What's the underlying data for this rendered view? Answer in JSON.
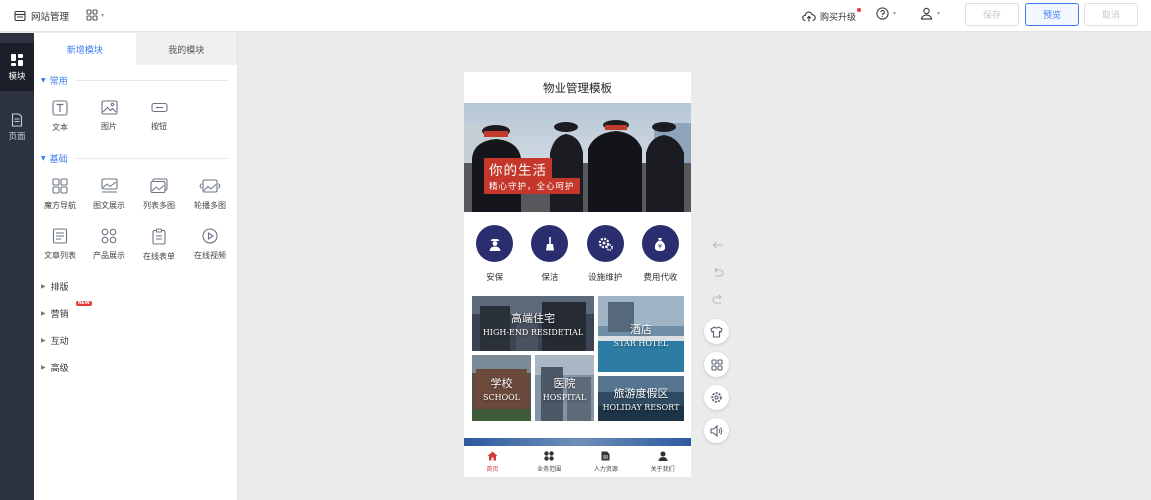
{
  "header": {
    "site_title": "网站管理",
    "upgrade_label": "购买升级",
    "save_label": "保存",
    "preview_label": "预览",
    "cancel_label": "取消"
  },
  "rail": {
    "items": [
      {
        "label": "模块",
        "icon": "modules-icon"
      },
      {
        "label": "页面",
        "icon": "page-icon"
      }
    ]
  },
  "panel": {
    "tabs": [
      "新增模块",
      "我的模块"
    ],
    "sections": {
      "common": {
        "title": "常用",
        "items": [
          "文本",
          "图片",
          "按钮"
        ]
      },
      "basic": {
        "title": "基础",
        "items": [
          "魔方导航",
          "图文展示",
          "列表多图",
          "轮播多图",
          "文章列表",
          "产品展示",
          "在线表单",
          "在线视频"
        ]
      },
      "collapsed": [
        "排版",
        "营销",
        "互动",
        "高级"
      ],
      "new_badge": "NEW"
    }
  },
  "phone": {
    "title": "物业管理模板",
    "banner": {
      "caption_main": "你的生活",
      "caption_sub": "精心守护，全心呵护"
    },
    "services": [
      "安保",
      "保洁",
      "设施维护",
      "费用代收"
    ],
    "tiles": [
      {
        "zh": "高端住宅",
        "en": "HIGH-END RESIDETIAL"
      },
      {
        "zh": "酒店",
        "en": "STAR HOTEL"
      },
      {
        "zh": "学校",
        "en": "SCHOOL"
      },
      {
        "zh": "医院",
        "en": "HOSPITAL"
      },
      {
        "zh": "旅游度假区",
        "en": "HOLIDAY RESORT"
      }
    ],
    "bottom_nav": [
      "首页",
      "业务范围",
      "人力资源",
      "关于我们"
    ]
  },
  "colors": {
    "accent": "#3c7cf0",
    "rail_bg": "#2c3240",
    "service_circle": "#2a2d6e",
    "banner_caption": "#c4372a",
    "nav_active": "#d23c3c"
  }
}
